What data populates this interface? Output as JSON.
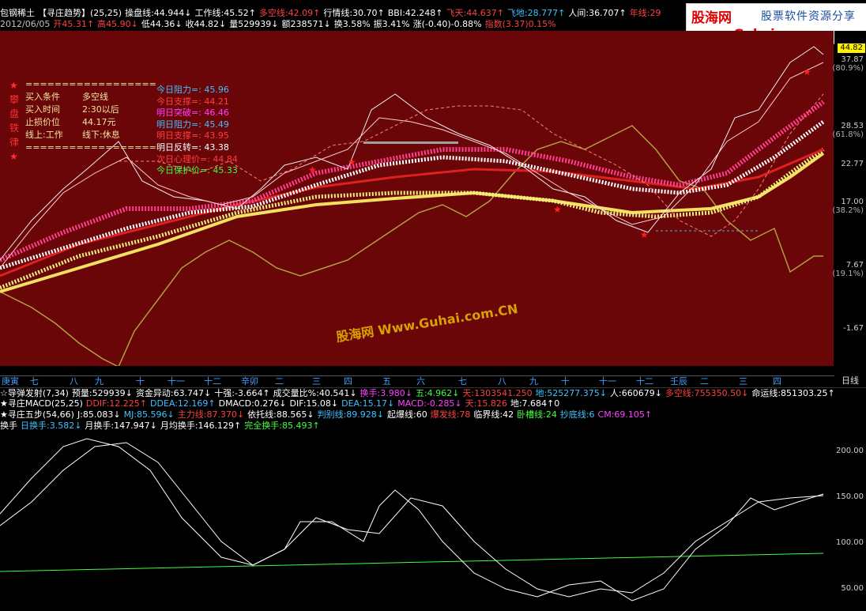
{
  "header1": [
    {
      "text": "包钢稀土",
      "color": "#ffffff"
    },
    {
      "text": "【寻庄趋势】(25,25)",
      "color": "#ffffff"
    },
    {
      "text": "操盘线:44.944↓",
      "color": "#ffffff"
    },
    {
      "text": "工作线:45.52↑",
      "color": "#ffffff"
    },
    {
      "text": "多空线:42.09↑",
      "color": "#ff4040"
    },
    {
      "text": "行情线:30.70↑",
      "color": "#ffffff"
    },
    {
      "text": "BBI:42.248↑",
      "color": "#ffffff"
    },
    {
      "text": "飞天:44.637↑",
      "color": "#ff4040"
    },
    {
      "text": "飞地:28.777↑",
      "color": "#40c0ff"
    },
    {
      "text": "人间:36.707↑",
      "color": "#ffffff"
    },
    {
      "text": "年线:29",
      "color": "#ff4040"
    }
  ],
  "header2": [
    {
      "text": "2012/06/05",
      "color": "#c0c0c0"
    },
    {
      "text": "开45.31↑",
      "color": "#ff4040"
    },
    {
      "text": "高45.90↓",
      "color": "#ff4040"
    },
    {
      "text": "低44.36↓",
      "color": "#ffffff"
    },
    {
      "text": "收44.82↓",
      "color": "#ffffff"
    },
    {
      "text": "量529939↓",
      "color": "#ffffff"
    },
    {
      "text": "额238571↓",
      "color": "#ffffff"
    },
    {
      "text": "换3.58%",
      "color": "#ffffff"
    },
    {
      "text": "振3.41%",
      "color": "#ffffff"
    },
    {
      "text": "涨(-0.40)-0.88%",
      "color": "#ffffff"
    },
    {
      "text": "指数(3.37)0.15%",
      "color": "#ff4040"
    }
  ],
  "logo": {
    "name": "股海网",
    "slogan": "股票软件资源分享",
    "url": "www.Guhai.com.cn"
  },
  "info_box": {
    "separator": "==================",
    "rows": [
      {
        "label": "买入条件",
        "value": "多空线"
      },
      {
        "label": "买入时间",
        "value": "2:30以后"
      },
      {
        "label": "止损价位",
        "value": "44.17元"
      },
      {
        "label": "线上:工作",
        "value": "线下:休息"
      }
    ],
    "side_chars": [
      "★",
      "攀",
      "盘",
      "铁",
      "律",
      "★"
    ]
  },
  "levels": [
    {
      "text": "今日阻力=: 45.96",
      "color": "#40c0ff"
    },
    {
      "text": "今日支撑=: 44.21",
      "color": "#ff4040"
    },
    {
      "text": "明日突破=: 46.46",
      "color": "#ff40ff"
    },
    {
      "text": "明日阻力=: 45.49",
      "color": "#40c0ff"
    },
    {
      "text": "明日支撑=: 43.95",
      "color": "#ff4040"
    },
    {
      "text": "明日反转=: 43.38",
      "color": "#ffffff"
    },
    {
      "text": "次日心理价=: 44.84",
      "color": "#ff4040"
    },
    {
      "text": "今日保护价=: 45.33",
      "color": "#40ff40"
    }
  ],
  "price_axis": {
    "current_badge": "44.82",
    "ticks": [
      {
        "value": "37.87",
        "pct": "(80.9%)"
      },
      {
        "value": "28.53",
        "pct": "(61.8%)"
      },
      {
        "value": "22.77",
        "pct": ""
      },
      {
        "value": "17.00",
        "pct": "(38.2%)"
      },
      {
        "value": "7.67",
        "pct": "(19.1%)"
      },
      {
        "value": "-1.67",
        "pct": ""
      }
    ]
  },
  "watermark": "股海网 Www.Guhai.com.CN",
  "months": [
    "庚寅",
    "七",
    "八",
    "九",
    "十",
    "十一",
    "十二",
    "辛卯",
    "二",
    "三",
    "四",
    "五",
    "六",
    "七",
    "八",
    "九",
    "十",
    "十一",
    "十二",
    "壬辰",
    "二",
    "三",
    "四"
  ],
  "period": "日线",
  "indicator_rows": [
    [
      {
        "text": "☆导弹发射(7,34)",
        "color": "#ffffff"
      },
      {
        "text": "预量:529939↓",
        "color": "#ffffff"
      },
      {
        "text": "资金异动:63.747↓",
        "color": "#ffffff"
      },
      {
        "text": "十强:-3.664↑",
        "color": "#ffffff"
      },
      {
        "text": "成交量比%:40.541↓",
        "color": "#ffffff"
      },
      {
        "text": "换手:3.980↓",
        "color": "#ff40ff"
      },
      {
        "text": "五:4.962↓",
        "color": "#40ff40"
      },
      {
        "text": "天:1303541.250",
        "color": "#ff4040"
      },
      {
        "text": "地:525277.375↓",
        "color": "#40c0ff"
      },
      {
        "text": "人:660679↓",
        "color": "#ffffff"
      },
      {
        "text": "多空线:755350.50↓",
        "color": "#ff4040"
      },
      {
        "text": "命运线:851303.25↑",
        "color": "#ffffff"
      }
    ],
    [
      {
        "text": "★寻庄MACD(25,25)",
        "color": "#ffffff"
      },
      {
        "text": "DDIF:12.225↑",
        "color": "#ff4040"
      },
      {
        "text": "DDEA:12.169↑",
        "color": "#40c0ff"
      },
      {
        "text": "DMACD:0.276↓",
        "color": "#ffffff"
      },
      {
        "text": "DIF:15.08↓",
        "color": "#ffffff"
      },
      {
        "text": "DEA:15.17↓",
        "color": "#40c0ff"
      },
      {
        "text": "MACD:-0.285↓",
        "color": "#ff40ff"
      },
      {
        "text": "天:15.826",
        "color": "#ff4040"
      },
      {
        "text": "地:7.684↑0",
        "color": "#ffffff"
      }
    ],
    [
      {
        "text": "★寻庄五步(54,66)",
        "color": "#ffffff"
      },
      {
        "text": "J:85.083↓",
        "color": "#ffffff"
      },
      {
        "text": "MJ:85.596↓",
        "color": "#40c0ff"
      },
      {
        "text": "主力线:87.370↓",
        "color": "#ff4040"
      },
      {
        "text": "依托线:88.565↓",
        "color": "#ffffff"
      },
      {
        "text": "判别线:89.928↓",
        "color": "#40c0ff"
      },
      {
        "text": "起爆线:60",
        "color": "#ffffff"
      },
      {
        "text": "爆发线:78",
        "color": "#ff4040"
      },
      {
        "text": "临界线:42",
        "color": "#ffffff"
      },
      {
        "text": "卧槽线:24",
        "color": "#40ff40"
      },
      {
        "text": "抄底线:6",
        "color": "#40c0ff"
      },
      {
        "text": "CM:69.105↑",
        "color": "#ff40ff"
      }
    ],
    [
      {
        "text": "换手",
        "color": "#ffffff"
      },
      {
        "text": "日换手:3.582↓",
        "color": "#40c0ff"
      },
      {
        "text": "月换手:147.947↓",
        "color": "#ffffff"
      },
      {
        "text": "月均换手:146.129↑",
        "color": "#ffffff"
      },
      {
        "text": "完全换手:85.493↑",
        "color": "#40ff40"
      }
    ]
  ],
  "lower_axis": {
    "ticks": [
      "200.00",
      "150.00",
      "100.00",
      "50.00"
    ]
  }
}
